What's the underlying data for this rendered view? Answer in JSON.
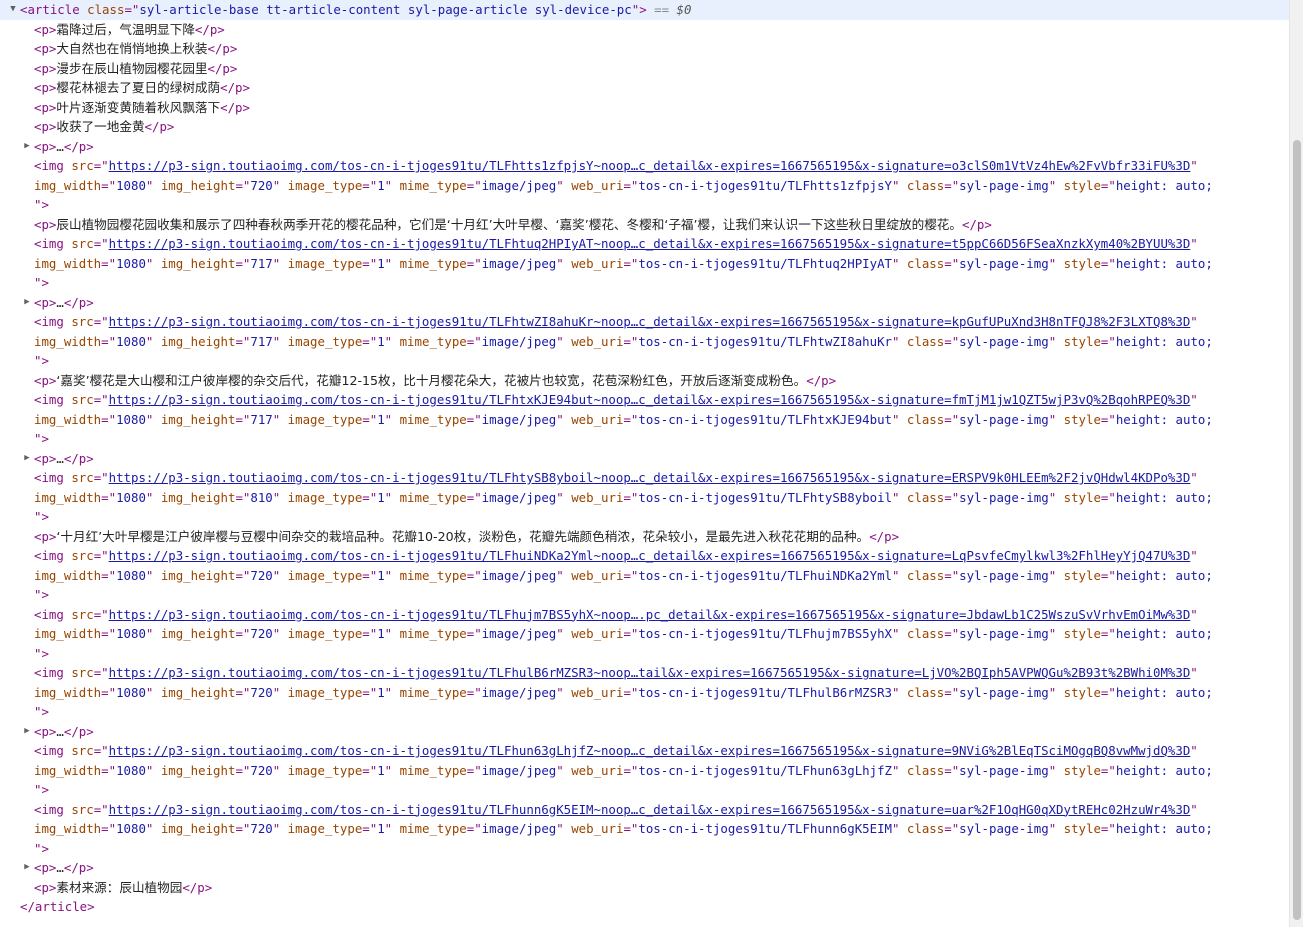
{
  "article_open": {
    "tag": "article",
    "class_attr": "class",
    "class_value": "syl-article-base tt-article-content syl-page-article syl-device-pc",
    "eq": "==",
    "dollar": "$0"
  },
  "paragraphs_top": [
    "霜降过后，气温明显下降",
    "大自然也在悄悄地换上秋装",
    "漫步在辰山植物园樱花园里",
    "樱花林褪去了夏日的绿树成荫",
    "叶片逐渐变黄随着秋风飘落下",
    "收获了一地金黄"
  ],
  "collapsed_p": "…",
  "img_attrs": {
    "src": "src",
    "img_width": "img_width",
    "img_height": "img_height",
    "image_type": "image_type",
    "mime_type": "mime_type",
    "web_uri": "web_uri",
    "class": "class",
    "style": "style",
    "image_type_value": "1",
    "mime_type_value": "image/jpeg",
    "class_value": "syl-page-img",
    "style_value": "height: auto;",
    "close": "\">"
  },
  "images": [
    {
      "src": "https://p3-sign.toutiaoimg.com/tos-cn-i-tjoges91tu/TLFhtts1zfpjsY~noop…c_detail&x-expires=1667565195&x-signature=o3clS0m1VtVz4hEw%2FvVbfr33iFU%3D",
      "w": "1080",
      "h": "720",
      "uri": "tos-cn-i-tjoges91tu/TLFhtts1zfpjsY"
    },
    {
      "src": "https://p3-sign.toutiaoimg.com/tos-cn-i-tjoges91tu/TLFhtuq2HPIyAT~noop…c_detail&x-expires=1667565195&x-signature=t5ppC66D56FSeaXnzkXym40%2BYUU%3D",
      "w": "1080",
      "h": "717",
      "uri": "tos-cn-i-tjoges91tu/TLFhtuq2HPIyAT"
    },
    {
      "src": "https://p3-sign.toutiaoimg.com/tos-cn-i-tjoges91tu/TLFhtwZI8ahuKr~noop…c_detail&x-expires=1667565195&x-signature=kpGufUPuXnd3H8nTFQJ8%2F3LXTQ8%3D",
      "w": "1080",
      "h": "717",
      "uri": "tos-cn-i-tjoges91tu/TLFhtwZI8ahuKr"
    },
    {
      "src": "https://p3-sign.toutiaoimg.com/tos-cn-i-tjoges91tu/TLFhtxKJE94but~noop…c_detail&x-expires=1667565195&x-signature=fmTjM1jw1QZT5wjP3vQ%2BqohRPEQ%3D",
      "w": "1080",
      "h": "717",
      "uri": "tos-cn-i-tjoges91tu/TLFhtxKJE94but"
    },
    {
      "src": "https://p3-sign.toutiaoimg.com/tos-cn-i-tjoges91tu/TLFhtySB8yboil~noop…c_detail&x-expires=1667565195&x-signature=ERSPV9k0HLEEm%2F2jvQHdwl4KDPo%3D",
      "w": "1080",
      "h": "810",
      "uri": "tos-cn-i-tjoges91tu/TLFhtySB8yboil"
    },
    {
      "src": "https://p3-sign.toutiaoimg.com/tos-cn-i-tjoges91tu/TLFhuiNDKa2Yml~noop…c_detail&x-expires=1667565195&x-signature=LqPsvfeCmylkwl3%2FhlHeyYjQ47U%3D",
      "w": "1080",
      "h": "720",
      "uri": "tos-cn-i-tjoges91tu/TLFhuiNDKa2Yml"
    },
    {
      "src": "https://p3-sign.toutiaoimg.com/tos-cn-i-tjoges91tu/TLFhujm7BS5yhX~noop….pc_detail&x-expires=1667565195&x-signature=JbdawLb1C25WszuSvVrhvEmOiMw%3D",
      "w": "1080",
      "h": "720",
      "uri": "tos-cn-i-tjoges91tu/TLFhujm7BS5yhX"
    },
    {
      "src": "https://p3-sign.toutiaoimg.com/tos-cn-i-tjoges91tu/TLFhulB6rMZSR3~noop…tail&x-expires=1667565195&x-signature=LjVO%2BQIph5AVPWQGu%2B93t%2BWhi0M%3D",
      "w": "1080",
      "h": "720",
      "uri": "tos-cn-i-tjoges91tu/TLFhulB6rMZSR3"
    },
    {
      "src": "https://p3-sign.toutiaoimg.com/tos-cn-i-tjoges91tu/TLFhun63gLhjfZ~noop…c_detail&x-expires=1667565195&x-signature=9NViG%2BlEqTSciMOgqBQ8vwMwjdQ%3D",
      "w": "1080",
      "h": "720",
      "uri": "tos-cn-i-tjoges91tu/TLFhun63gLhjfZ"
    },
    {
      "src": "https://p3-sign.toutiaoimg.com/tos-cn-i-tjoges91tu/TLFhunn6gK5EIM~noop…c_detail&x-expires=1667565195&x-signature=uar%2F1OqHG0qXDytREHc02HzuWr4%3D",
      "w": "1080",
      "h": "720",
      "uri": "tos-cn-i-tjoges91tu/TLFhunn6gK5EIM"
    }
  ],
  "paragraph_mid_1": "辰山植物园樱花园收集和展示了四种春秋两季开花的樱花品种，它们是‘十月红’大叶早樱、‘嘉奖’樱花、冬樱和‘子福’樱，让我们来认识一下这些秋日里绽放的樱花。",
  "paragraph_mid_2": "‘嘉奖’樱花是大山樱和江户彼岸樱的杂交后代，花瓣12-15枚，比十月樱花朵大，花被片也较宽，花苞深粉红色，开放后逐渐变成粉色。",
  "paragraph_mid_3": "‘十月红’大叶早樱是江户彼岸樱与豆樱中间杂交的栽培品种。花瓣10-20枚，淡粉色，花瓣先端颜色稍浓，花朵较小，是最先进入秋花花期的品种。",
  "paragraph_last": "素材来源：辰山植物园",
  "article_close": "article"
}
